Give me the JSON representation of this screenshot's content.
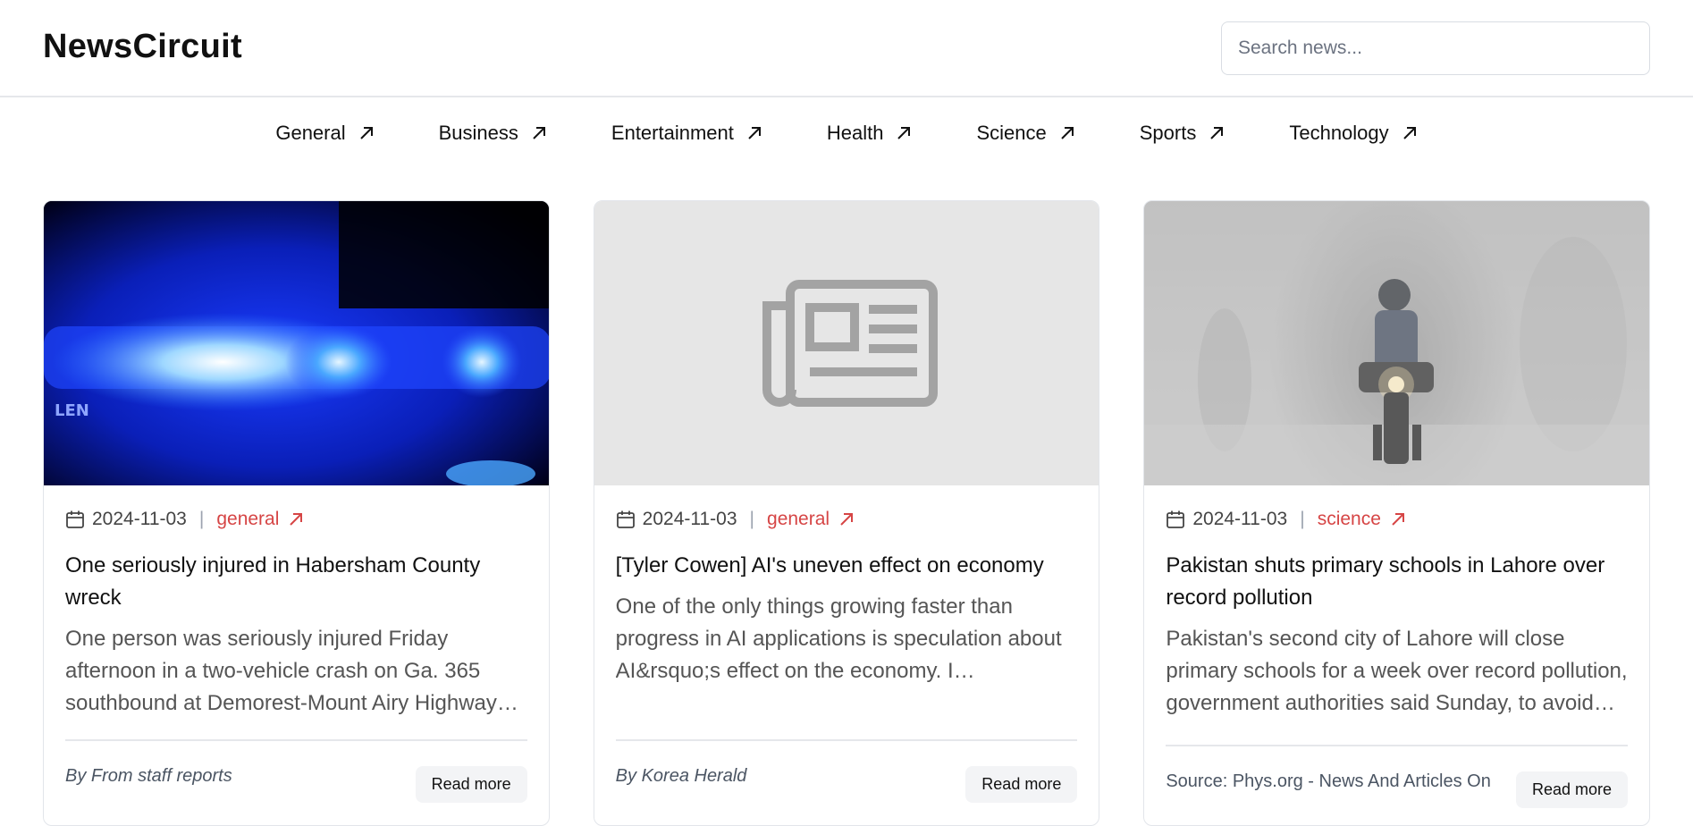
{
  "header": {
    "logo": "NewsCircuit",
    "search_placeholder": "Search news..."
  },
  "nav": {
    "items": [
      {
        "label": "General"
      },
      {
        "label": "Business"
      },
      {
        "label": "Entertainment"
      },
      {
        "label": "Health"
      },
      {
        "label": "Science"
      },
      {
        "label": "Sports"
      },
      {
        "label": "Technology"
      }
    ]
  },
  "articles": [
    {
      "date": "2024-11-03",
      "category": "general",
      "title": "One seriously injured in Habersham County wreck",
      "description": "One person was seriously injured Friday afternoon in a two-vehicle crash on Ga. 365 southbound at Demorest-Mount Airy Highway i…",
      "author": "By From staff reports",
      "button": "Read more"
    },
    {
      "date": "2024-11-03",
      "category": "general",
      "title": "[Tyler Cowen] AI's uneven effect on economy",
      "description": "One of the only things growing faster than progress in AI applications is speculation about AI&rsquo;s effect on the economy. I don&rsquo;…",
      "author": "By Korea Herald",
      "button": "Read more"
    },
    {
      "date": "2024-11-03",
      "category": "science",
      "title": "Pakistan shuts primary schools in Lahore over record pollution",
      "description": "Pakistan's second city of Lahore will close primary schools for a week over record pollution, government authorities said Sunday, to avoid…",
      "author": "Source: Phys.org - News And Articles On",
      "button": "Read more"
    }
  ],
  "colors": {
    "accent": "#d64545",
    "border": "#e5e7eb",
    "muted_text": "#555555"
  }
}
